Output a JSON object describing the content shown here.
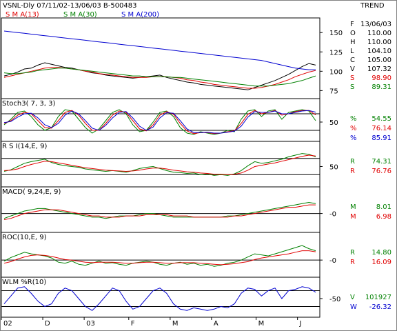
{
  "chart_data": {
    "type": "line",
    "header": {
      "title": "VSNL-Dly 07/11/02-13/06/03  B-500483",
      "right_label": "TREND",
      "sma_labels": [
        "S M A(13)",
        "S M A(30)",
        "S M A(200)"
      ],
      "sma_colors": [
        "#e00000",
        "#008000",
        "#0000d0"
      ]
    },
    "x_axis": {
      "labels": [
        "02",
        "D",
        "03",
        "F",
        "M",
        "A",
        "M",
        "J"
      ],
      "label_pos": [
        0.0,
        0.13,
        0.26,
        0.4,
        0.53,
        0.66,
        0.8,
        0.93
      ]
    },
    "panels": [
      {
        "id": "price",
        "ylim": [
          70,
          160
        ],
        "yticks": [
          75,
          100,
          125,
          150
        ],
        "hlines": [],
        "readout": [
          {
            "label": "F",
            "value": "13/06/03",
            "color": "#000000"
          },
          {
            "label": "O",
            "value": "110.00",
            "color": "#000000"
          },
          {
            "label": "H",
            "value": "110.00",
            "color": "#000000"
          },
          {
            "label": "L",
            "value": "104.10",
            "color": "#000000"
          },
          {
            "label": "C",
            "value": "105.00",
            "color": "#000000"
          },
          {
            "label": "V",
            "value": "107.32",
            "color": "#000000"
          },
          {
            "label": "S",
            "value": "98.90",
            "color": "#e00000"
          },
          {
            "label": "S",
            "value": "89.31",
            "color": "#008000"
          }
        ],
        "series": [
          {
            "name": "Price",
            "color": "#000000",
            "values": [
              94,
              96,
              99,
              103,
              104,
              108,
              111,
              109,
              107,
              105,
              104,
              102,
              100,
              98,
              97,
              95,
              94,
              93,
              92,
              91,
              92,
              93,
              94,
              95,
              92,
              90,
              88,
              86,
              85,
              83,
              82,
              81,
              80,
              79,
              78,
              77,
              76,
              79,
              82,
              85,
              88,
              92,
              96,
              101,
              106,
              110,
              108
            ]
          },
          {
            "name": "SMA 13",
            "color": "#e00000",
            "values": [
              92,
              94,
              96,
              98,
              100,
              102,
              104,
              105,
              105,
              104,
              103,
              102,
              100,
              99,
              97,
              96,
              95,
              94,
              93,
              92,
              92,
              92,
              93,
              93,
              93,
              92,
              91,
              89,
              88,
              86,
              85,
              83,
              82,
              81,
              80,
              79,
              78,
              78,
              79,
              81,
              83,
              86,
              89,
              93,
              96,
              99,
              101
            ]
          },
          {
            "name": "SMA 30",
            "color": "#008000",
            "values": [
              98,
              97,
              97,
              98,
              99,
              101,
              102,
              103,
              104,
              104,
              103,
              102,
              101,
              100,
              99,
              98,
              97,
              96,
              95,
              94,
              94,
              93,
              93,
              93,
              93,
              92,
              92,
              91,
              90,
              89,
              88,
              87,
              86,
              85,
              84,
              83,
              82,
              81,
              81,
              81,
              82,
              83,
              84,
              86,
              88,
              91,
              94
            ]
          },
          {
            "name": "SMA 200",
            "color": "#0000d0",
            "values": [
              152,
              151,
              150,
              149,
              148,
              147,
              146,
              145,
              144,
              143,
              142,
              141,
              140,
              139,
              138,
              137,
              136,
              135,
              134,
              133,
              132,
              131,
              130,
              129,
              128,
              127,
              126,
              125,
              124,
              123,
              122,
              121,
              120,
              119,
              118,
              117,
              116,
              115,
              114,
              112,
              110,
              108,
              106,
              104,
              103,
              102,
              102
            ]
          }
        ]
      },
      {
        "id": "stoch",
        "title": "Stoch3( 7, 3, 3)",
        "ylim": [
          -5,
          110
        ],
        "yticks": [
          50
        ],
        "hlines": [
          20,
          80
        ],
        "readout": [
          {
            "label": "%",
            "value": "54.55",
            "color": "#008000"
          },
          {
            "label": "%",
            "value": "76.14",
            "color": "#e00000"
          },
          {
            "label": "%",
            "value": "85.91",
            "color": "#0000d0"
          }
        ],
        "series": [
          {
            "name": "%K",
            "color": "#008000",
            "values": [
              40,
              60,
              85,
              90,
              70,
              40,
              20,
              30,
              70,
              95,
              90,
              60,
              30,
              10,
              25,
              55,
              85,
              95,
              80,
              40,
              15,
              20,
              50,
              85,
              90,
              70,
              30,
              10,
              5,
              15,
              10,
              5,
              10,
              20,
              15,
              60,
              90,
              95,
              70,
              90,
              95,
              60,
              85,
              90,
              95,
              90,
              55
            ]
          },
          {
            "name": "%D",
            "color": "#e00000",
            "values": [
              45,
              55,
              75,
              85,
              80,
              55,
              30,
              28,
              55,
              85,
              92,
              75,
              45,
              20,
              20,
              45,
              75,
              90,
              85,
              55,
              25,
              18,
              40,
              75,
              88,
              78,
              45,
              18,
              8,
              12,
              12,
              8,
              10,
              15,
              18,
              45,
              78,
              92,
              80,
              85,
              92,
              75,
              80,
              88,
              92,
              92,
              76
            ]
          },
          {
            "name": "%D slow",
            "color": "#0000d0",
            "values": [
              48,
              52,
              68,
              80,
              82,
              65,
              40,
              30,
              45,
              75,
              90,
              80,
              55,
              28,
              20,
              38,
              65,
              85,
              88,
              65,
              35,
              20,
              32,
              65,
              84,
              82,
              55,
              25,
              12,
              12,
              13,
              10,
              10,
              13,
              17,
              35,
              68,
              88,
              85,
              85,
              90,
              80,
              80,
              85,
              90,
              92,
              86
            ]
          }
        ]
      },
      {
        "id": "rsi",
        "title": "R S I(14,E, 9)",
        "ylim": [
          10,
          95
        ],
        "yticks": [
          50
        ],
        "hlines": [
          30,
          70
        ],
        "readout": [
          {
            "label": "R",
            "value": "74.31",
            "color": "#008000"
          },
          {
            "label": "R",
            "value": "76.76",
            "color": "#e00000"
          }
        ],
        "series": [
          {
            "name": "RSI",
            "color": "#008000",
            "values": [
              38,
              42,
              50,
              58,
              62,
              65,
              68,
              60,
              55,
              52,
              50,
              48,
              44,
              42,
              40,
              38,
              40,
              38,
              36,
              40,
              45,
              48,
              50,
              45,
              40,
              36,
              35,
              33,
              34,
              30,
              32,
              28,
              30,
              28,
              32,
              40,
              52,
              62,
              58,
              60,
              64,
              68,
              74,
              78,
              82,
              80,
              74
            ]
          },
          {
            "name": "Signal",
            "color": "#e00000",
            "values": [
              40,
              41,
              44,
              50,
              55,
              59,
              63,
              62,
              59,
              56,
              53,
              50,
              47,
              45,
              43,
              41,
              40,
              39,
              38,
              39,
              41,
              44,
              46,
              46,
              44,
              41,
              39,
              37,
              36,
              34,
              33,
              31,
              31,
              30,
              31,
              34,
              41,
              50,
              53,
              56,
              59,
              63,
              67,
              71,
              75,
              78,
              76
            ]
          }
        ]
      },
      {
        "id": "macd",
        "title": "MACD( 9,24,E, 9)",
        "ylim": [
          -12,
          16
        ],
        "yticks": [
          0
        ],
        "tick_labels": [
          "-0"
        ],
        "hlines": [
          0
        ],
        "readout": [
          {
            "label": "M",
            "value": "8.01",
            "color": "#008000"
          },
          {
            "label": "M",
            "value": "6.98",
            "color": "#e00000"
          }
        ],
        "series": [
          {
            "name": "MACD",
            "color": "#008000",
            "values": [
              -4,
              -2,
              0,
              2,
              3,
              4,
              4,
              3,
              2,
              1,
              0,
              -1,
              -2,
              -3,
              -3,
              -4,
              -3,
              -2,
              -2,
              -2,
              -1,
              0,
              0,
              -1,
              -2,
              -3,
              -3,
              -3,
              -3,
              -3,
              -3,
              -3,
              -3,
              -2,
              -2,
              -1,
              0,
              1,
              2,
              3,
              4,
              5,
              6,
              7,
              8,
              9,
              8
            ]
          },
          {
            "name": "Signal",
            "color": "#e00000",
            "values": [
              -5,
              -4,
              -2,
              0,
              1,
              2,
              3,
              3,
              3,
              2,
              1,
              0,
              -1,
              -2,
              -2,
              -3,
              -3,
              -3,
              -2,
              -2,
              -2,
              -1,
              -1,
              -1,
              -1,
              -2,
              -2,
              -2,
              -3,
              -3,
              -3,
              -3,
              -3,
              -3,
              -2,
              -2,
              -1,
              0,
              1,
              2,
              3,
              4,
              5,
              5,
              6,
              7,
              7
            ]
          }
        ]
      },
      {
        "id": "roc",
        "title": "ROC(10,E, 9)",
        "ylim": [
          -25,
          40
        ],
        "yticks": [
          0
        ],
        "tick_labels": [
          "-0"
        ],
        "hlines": [
          0
        ],
        "readout": [
          {
            "label": "R",
            "value": "14.80",
            "color": "#008000"
          },
          {
            "label": "R",
            "value": "16.09",
            "color": "#e00000"
          }
        ],
        "series": [
          {
            "name": "ROC",
            "color": "#008000",
            "values": [
              -2,
              5,
              10,
              15,
              12,
              10,
              8,
              4,
              -4,
              -6,
              -2,
              -8,
              -10,
              -6,
              -2,
              -6,
              -5,
              -8,
              -10,
              -6,
              -4,
              -2,
              -4,
              -8,
              -10,
              -6,
              -4,
              -8,
              -6,
              -10,
              -8,
              -12,
              -10,
              -6,
              -4,
              0,
              6,
              12,
              10,
              8,
              12,
              16,
              20,
              24,
              28,
              22,
              18
            ]
          },
          {
            "name": "Signal",
            "color": "#e00000",
            "values": [
              -6,
              -3,
              2,
              6,
              9,
              10,
              9,
              7,
              4,
              1,
              0,
              -2,
              -4,
              -5,
              -4,
              -4,
              -4,
              -5,
              -6,
              -6,
              -5,
              -4,
              -4,
              -5,
              -6,
              -6,
              -5,
              -5,
              -5,
              -6,
              -7,
              -8,
              -9,
              -8,
              -7,
              -5,
              -3,
              1,
              4,
              6,
              8,
              10,
              12,
              15,
              18,
              18,
              16
            ]
          }
        ]
      },
      {
        "id": "wlm",
        "title": "WLM %R(10)",
        "ylim": [
          -105,
          5
        ],
        "yticks": [
          -50
        ],
        "hlines": [
          -20,
          -80
        ],
        "readout": [
          {
            "label": "V",
            "value": "101927",
            "color": "#008000"
          },
          {
            "label": "W",
            "value": "-26.32",
            "color": "#0000d0"
          }
        ],
        "series": [
          {
            "name": "%R",
            "color": "#0000d0",
            "values": [
              -70,
              -40,
              -10,
              -5,
              -30,
              -60,
              -80,
              -70,
              -30,
              -10,
              -20,
              -50,
              -80,
              -95,
              -70,
              -40,
              -10,
              -20,
              -60,
              -90,
              -80,
              -50,
              -20,
              -10,
              -30,
              -70,
              -90,
              -95,
              -85,
              -90,
              -95,
              -90,
              -80,
              -85,
              -70,
              -30,
              -10,
              -15,
              -40,
              -20,
              -10,
              -50,
              -20,
              -15,
              -5,
              -10,
              -26
            ]
          }
        ]
      }
    ]
  }
}
